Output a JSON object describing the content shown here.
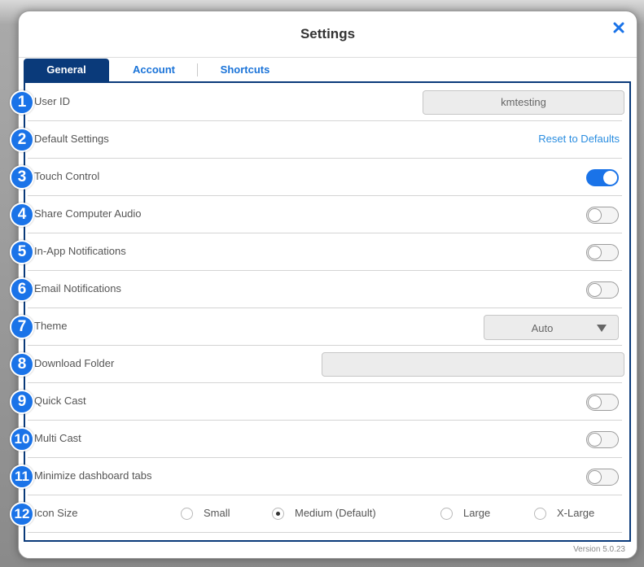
{
  "dialog": {
    "title": "Settings",
    "close_icon": "close-icon",
    "version": "Version 5.0.23"
  },
  "tabs": [
    {
      "label": "General",
      "active": true
    },
    {
      "label": "Account",
      "active": false
    },
    {
      "label": "Shortcuts",
      "active": false
    }
  ],
  "rows": {
    "user_id": {
      "badge": "1",
      "label": "User ID",
      "value": "kmtesting"
    },
    "default_settings": {
      "badge": "2",
      "label": "Default Settings",
      "action": "Reset to Defaults"
    },
    "touch_control": {
      "badge": "3",
      "label": "Touch Control",
      "on": true
    },
    "share_audio": {
      "badge": "4",
      "label": "Share Computer Audio",
      "on": false
    },
    "in_app_notifications": {
      "badge": "5",
      "label": "In-App Notifications",
      "on": false
    },
    "email_notifications": {
      "badge": "6",
      "label": "Email Notifications",
      "on": false
    },
    "theme": {
      "badge": "7",
      "label": "Theme",
      "selected": "Auto"
    },
    "download_folder": {
      "badge": "8",
      "label": "Download Folder",
      "value": ""
    },
    "quick_cast": {
      "badge": "9",
      "label": "Quick Cast",
      "on": false
    },
    "multi_cast": {
      "badge": "10",
      "label": "Multi Cast",
      "on": false
    },
    "minimize_tabs": {
      "badge": "11",
      "label": "Minimize dashboard tabs",
      "on": false
    },
    "icon_size": {
      "badge": "12",
      "label": "Icon Size",
      "options": [
        "Small",
        "Medium (Default)",
        "Large",
        "X-Large"
      ],
      "selected": "Medium (Default)"
    }
  },
  "colors": {
    "accent": "#1a73e8",
    "tab_active_bg": "#0a3a7a",
    "link": "#2a8de0"
  }
}
